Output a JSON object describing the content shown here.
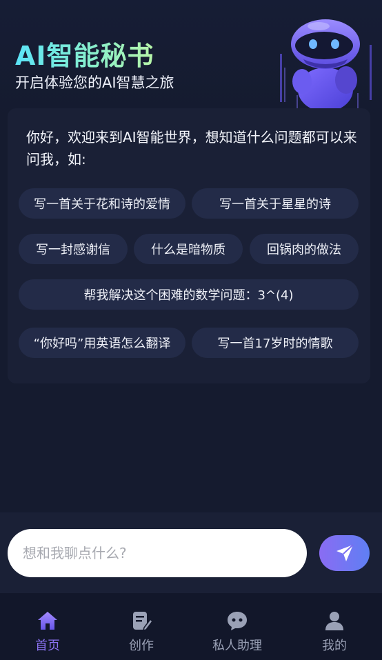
{
  "header": {
    "title": "AI智能秘书",
    "subtitle": "开启体验您的AI智慧之旅"
  },
  "chat": {
    "greeting": "你好，欢迎来到AI智能世界，想知道什么问题都可以来问我，如:",
    "suggestions": [
      "写一首关于花和诗的爱情",
      "写一首关于星星的诗",
      "写一封感谢信",
      "什么是暗物质",
      "回锅肉的做法",
      "帮我解决这个困难的数学问题：3^(4)",
      "“你好吗”用英语怎么翻译",
      "写一首17岁时的情歌"
    ]
  },
  "input": {
    "placeholder": "想和我聊点什么?"
  },
  "tabs": [
    {
      "label": "首页",
      "icon": "home-icon",
      "active": true
    },
    {
      "label": "创作",
      "icon": "edit-icon",
      "active": false
    },
    {
      "label": "私人助理",
      "icon": "chat-bubble-icon",
      "active": false
    },
    {
      "label": "我的",
      "icon": "user-icon",
      "active": false
    }
  ],
  "colors": {
    "background": "#151b2f",
    "card": "#1a2036",
    "chip": "#232b48",
    "accent": "#8d73f5",
    "title_gradient_start": "#5be3f7",
    "title_gradient_end": "#b8f5a8"
  }
}
